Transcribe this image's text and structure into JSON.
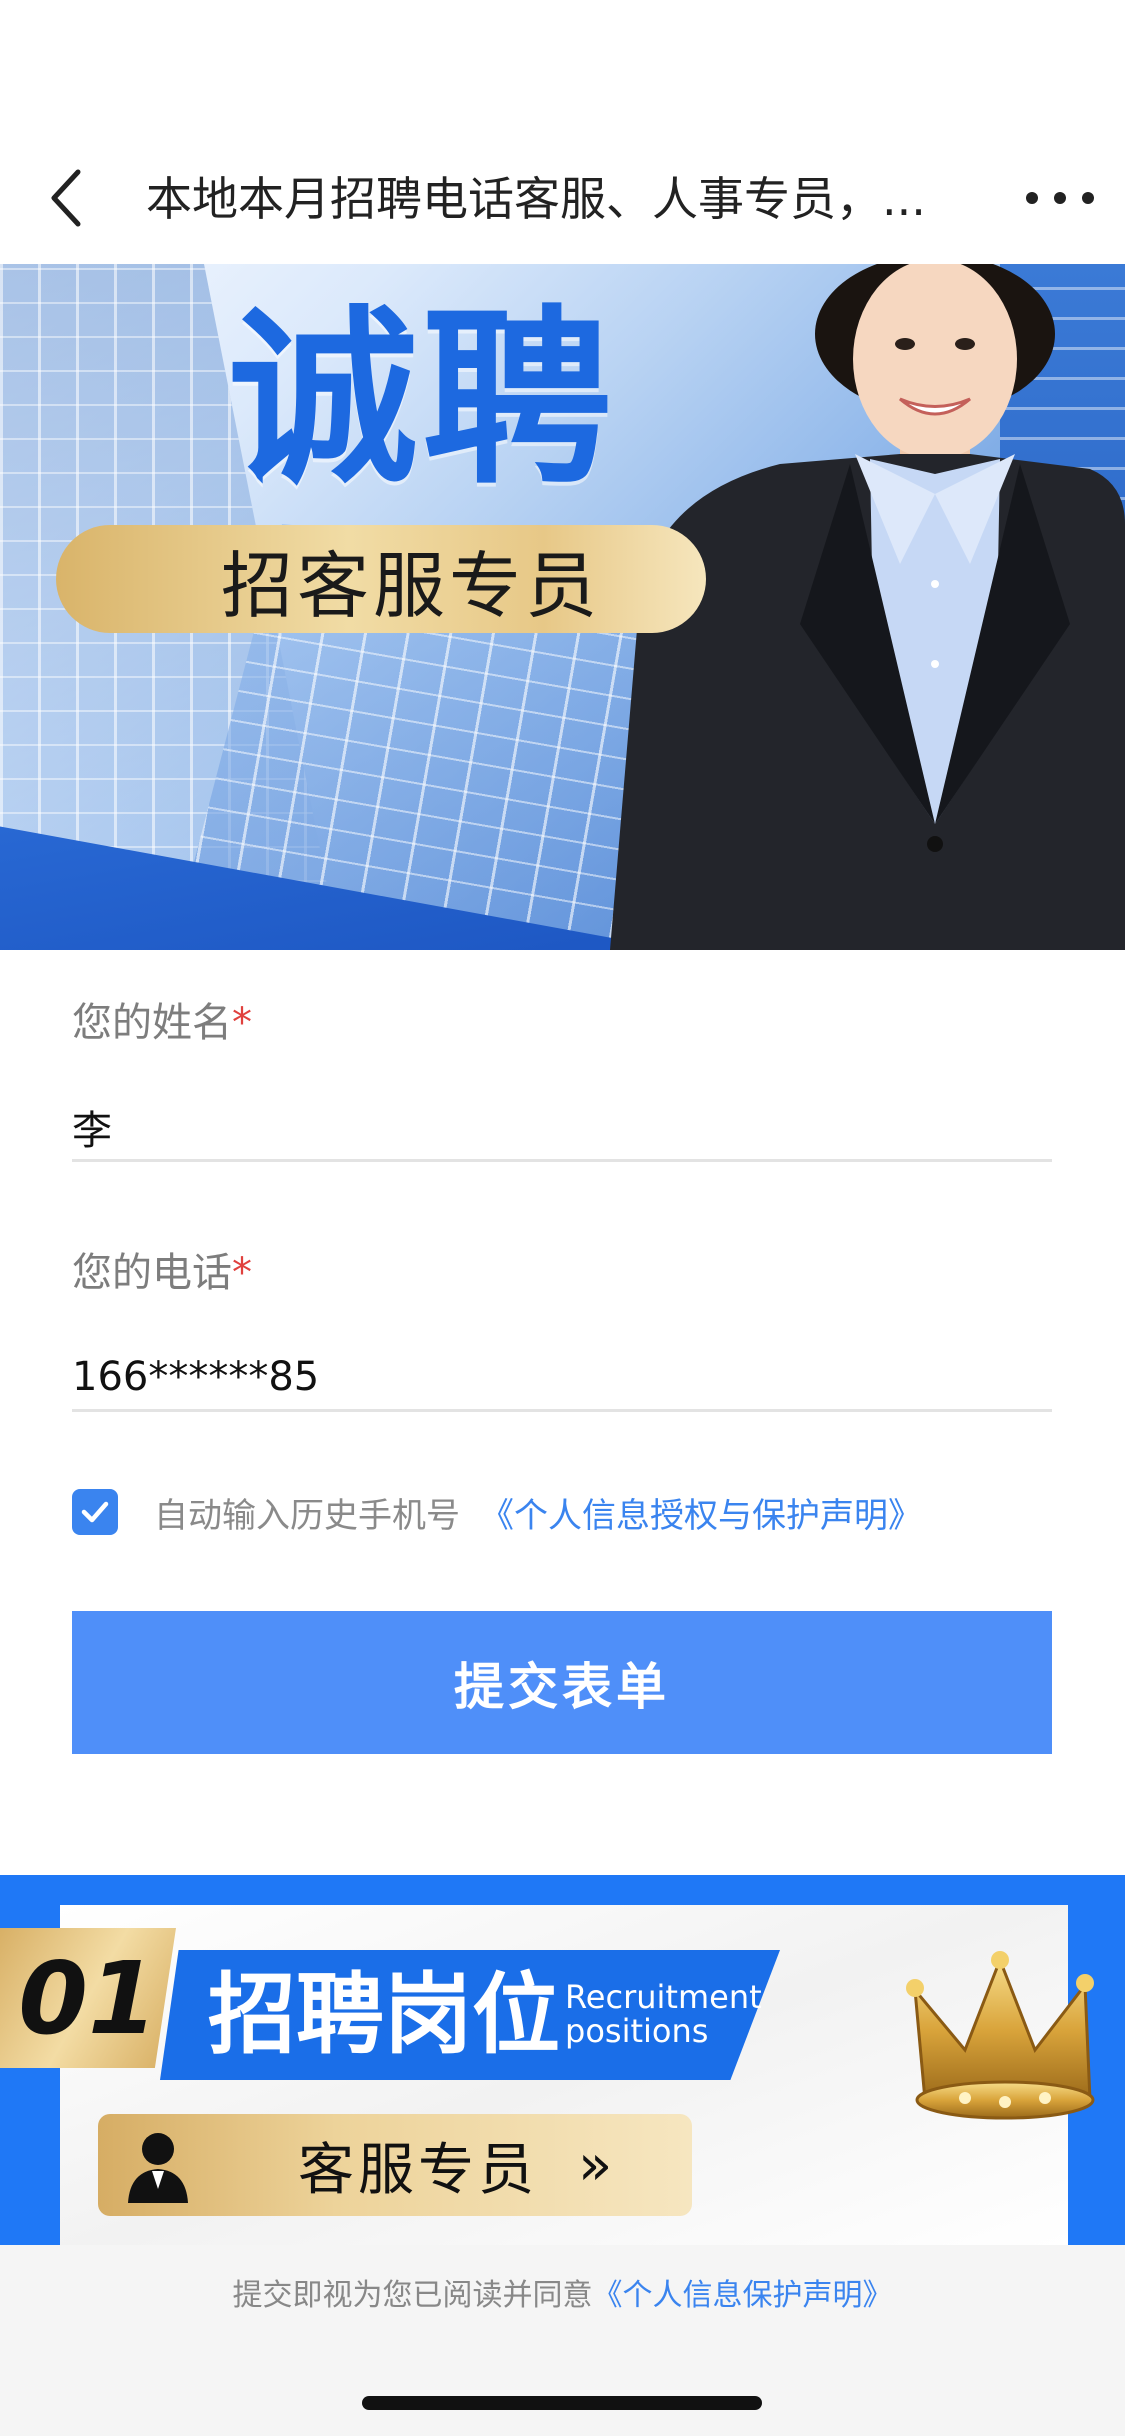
{
  "nav": {
    "title": "本地本月招聘电话客服、人事专员，..."
  },
  "banner": {
    "headline": "诚聘",
    "tagline": "招客服专员"
  },
  "form": {
    "name_label": "您的姓名",
    "name_value": "李",
    "phone_label": "您的电话",
    "phone_value": "166******85",
    "required_mark": "*",
    "auto_fill_checked": true,
    "auto_fill_text": "自动输入历史手机号",
    "privacy_link": "《个人信息授权与保护声明》",
    "submit_label": "提交表单"
  },
  "section": {
    "number": "01",
    "title": "招聘岗位",
    "subtitle_line1": "Recruitment",
    "subtitle_line2": "positions",
    "job_label": "客服专员",
    "job_arrow": "»"
  },
  "footer": {
    "consent_text": "提交即视为您已阅读并同意",
    "consent_link": "《个人信息保护声明》"
  },
  "colors": {
    "accent": "#4f8ff9",
    "link": "#3a84ef",
    "required": "#e0413e",
    "section_blue": "#1f78f6",
    "gold": "#e7c887"
  }
}
